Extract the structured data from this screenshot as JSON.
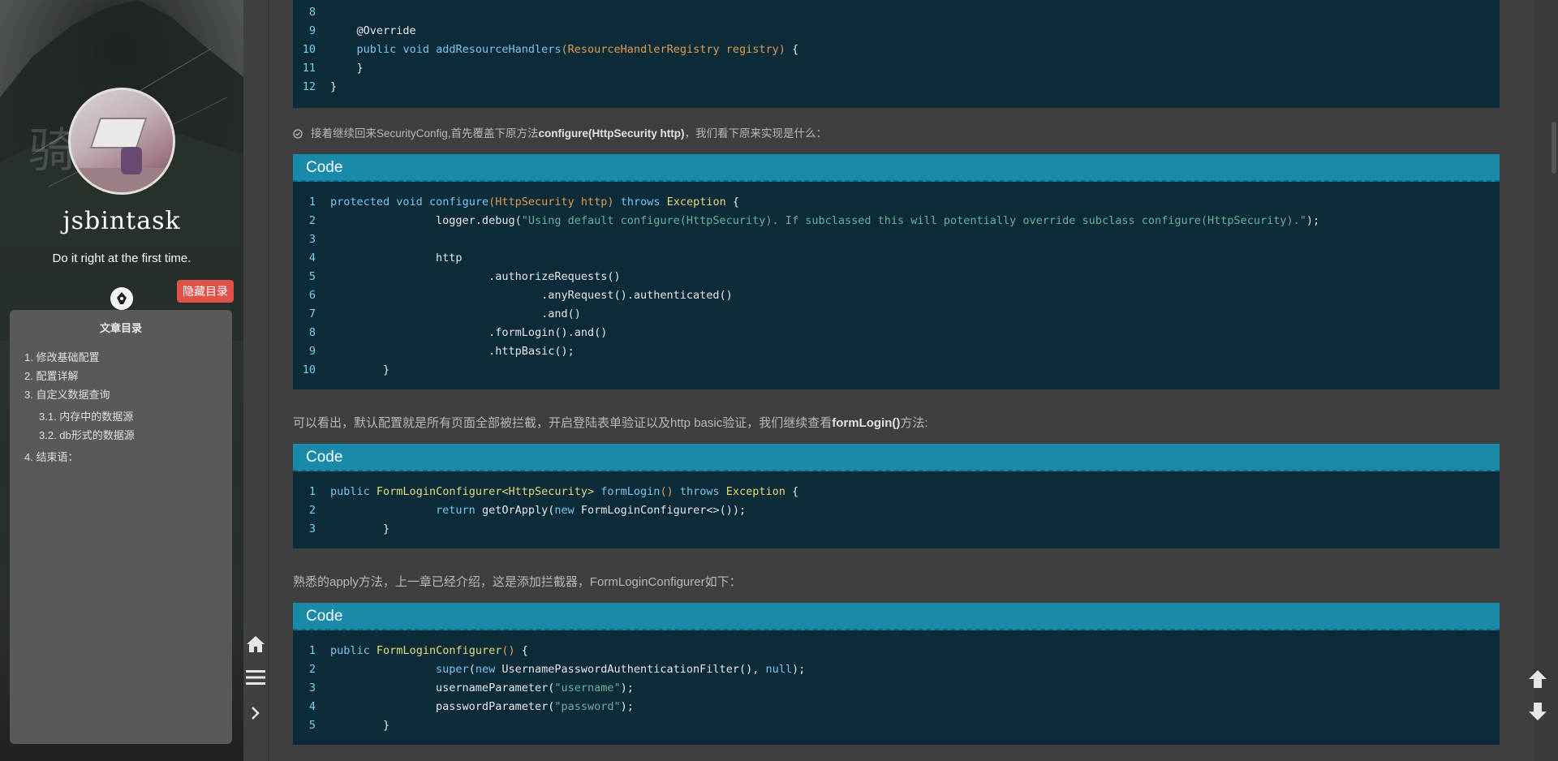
{
  "sidebar": {
    "watermark": "骑",
    "site_name": "jsbintask",
    "motto": "Do it right at the first time.",
    "hide_toc_label": "隐藏目录",
    "toc": {
      "title": "文章目录",
      "items": [
        {
          "label": "1. 修改基础配置",
          "level": 1
        },
        {
          "label": "2. 配置详解",
          "level": 1
        },
        {
          "label": "3. 自定义数据查询",
          "level": 1
        },
        {
          "label": "3.1. 内存中的数据源",
          "level": 2
        },
        {
          "label": "3.2. db形式的数据源",
          "level": 2
        },
        {
          "label": "4. 结束语：",
          "level": 1
        }
      ]
    }
  },
  "strip": {
    "home_icon": "home-icon",
    "menu_icon": "menu-icon",
    "expand_icon": "chevron-right-icon"
  },
  "content": {
    "top_code": {
      "lines": [
        {
          "n": "8",
          "html": ""
        },
        {
          "n": "9",
          "html": "    @Override"
        },
        {
          "n": "10",
          "html": "    <span class=\"kw\">public</span> <span class=\"kw\">void</span> <span class=\"fn\">addResourceHandlers</span><span class=\"pn\">(ResourceHandlerRegistry registry)</span> {"
        },
        {
          "n": "11",
          "html": "    }"
        },
        {
          "n": "12",
          "html": "}"
        }
      ]
    },
    "note_1": {
      "prefix": "接着继续回来SecurityConfig,首先覆盖下原方法",
      "bold": "configure(HttpSecurity http)",
      "suffix": "，我们看下原来实现是什么："
    },
    "block_1": {
      "label": "Code",
      "lines": [
        {
          "n": "1",
          "html": "<span class=\"kw\">protected</span> <span class=\"kw\">void</span> <span class=\"fn\">configure</span><span class=\"pn\">(HttpSecurity http)</span> <span class=\"kw\">throws</span> <span class=\"ty\">Exception</span> {"
        },
        {
          "n": "2",
          "html": "\t\tlogger.debug(<span class=\"st\">\"Using default configure(HttpSecurity). If subclassed this will potentially override subclass configure(HttpSecurity).\"</span>);"
        },
        {
          "n": "3",
          "html": ""
        },
        {
          "n": "4",
          "html": "\t\thttp"
        },
        {
          "n": "5",
          "html": "\t\t\t.authorizeRequests()"
        },
        {
          "n": "6",
          "html": "\t\t\t\t.anyRequest().authenticated()"
        },
        {
          "n": "7",
          "html": "\t\t\t\t.and()"
        },
        {
          "n": "8",
          "html": "\t\t\t.formLogin().and()"
        },
        {
          "n": "9",
          "html": "\t\t\t.httpBasic();"
        },
        {
          "n": "10",
          "html": "\t}"
        }
      ]
    },
    "para_1": {
      "prefix": "可以看出，默认配置就是所有页面全部被拦截，开启登陆表单验证以及http basic验证，我们继续查看",
      "bold": "formLogin()",
      "suffix": "方法:"
    },
    "block_2": {
      "label": "Code",
      "lines": [
        {
          "n": "1",
          "html": "<span class=\"kw\">public</span> <span class=\"ty\">FormLoginConfigurer&lt;HttpSecurity&gt;</span> <span class=\"fn\">formLogin</span><span class=\"pn\">()</span> <span class=\"kw\">throws</span> <span class=\"ty\">Exception</span> {"
        },
        {
          "n": "2",
          "html": "\t\t<span class=\"kw\">return</span> getOrApply(<span class=\"kw\">new</span> FormLoginConfigurer&lt;&gt;());"
        },
        {
          "n": "3",
          "html": "\t}"
        }
      ]
    },
    "para_2": {
      "text": "熟悉的apply方法，上一章已经介绍，这是添加拦截器，FormLoginConfigurer如下："
    },
    "block_3": {
      "label": "Code",
      "lines": [
        {
          "n": "1",
          "html": "<span class=\"kw\">public</span> <span class=\"ty\">FormLoginConfigurer</span><span class=\"pn\">()</span> {"
        },
        {
          "n": "2",
          "html": "\t\t<span class=\"kw\">super</span>(<span class=\"kw\">new</span> UsernamePasswordAuthenticationFilter(), <span class=\"nl\">null</span>);"
        },
        {
          "n": "3",
          "html": "\t\tusernameParameter(<span class=\"st\">\"username\"</span>);"
        },
        {
          "n": "4",
          "html": "\t\tpasswordParameter(<span class=\"st\">\"password\"</span>);"
        },
        {
          "n": "5",
          "html": "\t}"
        }
      ]
    }
  },
  "nav": {
    "up_icon": "arrow-up-icon",
    "down_icon": "arrow-down-icon"
  },
  "colors": {
    "code_header": "#1a8aaa",
    "code_bg": "#0b2b38",
    "hide_toc": "#e0524a",
    "keyword": "#7ec4ef",
    "type": "#e9d978",
    "string": "#6fae9a"
  }
}
